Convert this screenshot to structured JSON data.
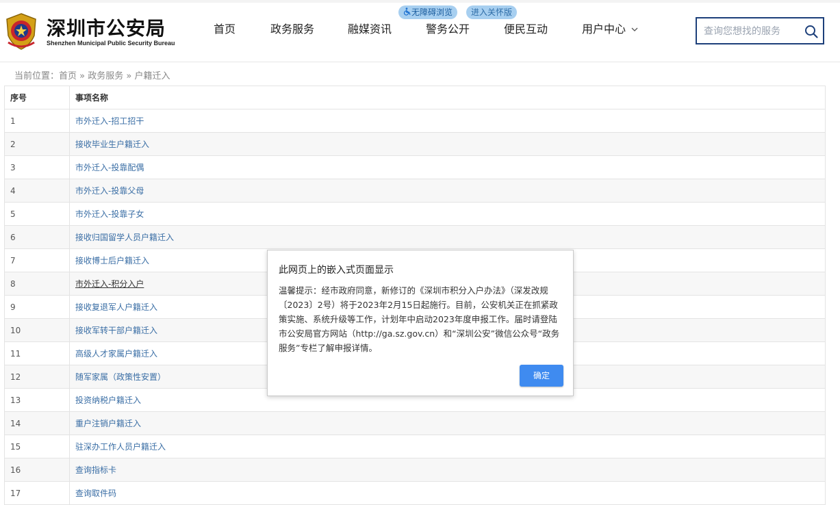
{
  "header": {
    "title_cn": "深圳市公安局",
    "title_en": "Shenzhen Municipal Public Security Bureau",
    "accessibility_label": "无障碍浏览",
    "elder_mode_label": "进入关怀版"
  },
  "nav": {
    "items": [
      "首页",
      "政务服务",
      "融媒资讯",
      "警务公开",
      "便民互动",
      "用户中心"
    ]
  },
  "search": {
    "placeholder": "查询您想找的服务"
  },
  "breadcrumb": {
    "prefix": "当前位置：",
    "home": "首页",
    "sep1": " » ",
    "section": "政务服务",
    "sep2": " » ",
    "current": "户籍迁入"
  },
  "table": {
    "headers": [
      "序号",
      "事项名称"
    ],
    "rows": [
      {
        "no": "1",
        "name": "市外迁入-招工招干"
      },
      {
        "no": "2",
        "name": "接收毕业生户籍迁入"
      },
      {
        "no": "3",
        "name": "市外迁入-投靠配偶"
      },
      {
        "no": "4",
        "name": "市外迁入-投靠父母"
      },
      {
        "no": "5",
        "name": "市外迁入-投靠子女"
      },
      {
        "no": "6",
        "name": "接收归国留学人员户籍迁入"
      },
      {
        "no": "7",
        "name": "接收博士后户籍迁入"
      },
      {
        "no": "8",
        "name": "市外迁入-积分入户"
      },
      {
        "no": "9",
        "name": "接收复退军人户籍迁入"
      },
      {
        "no": "10",
        "name": "接收军转干部户籍迁入"
      },
      {
        "no": "11",
        "name": "高级人才家属户籍迁入"
      },
      {
        "no": "12",
        "name": "随军家属（政策性安置）"
      },
      {
        "no": "13",
        "name": "投资纳税户籍迁入"
      },
      {
        "no": "14",
        "name": "重户注销户籍迁入"
      },
      {
        "no": "15",
        "name": "驻深办工作人员户籍迁入"
      },
      {
        "no": "16",
        "name": "查询指标卡"
      },
      {
        "no": "17",
        "name": "查询取件码"
      }
    ]
  },
  "dialog": {
    "title": "此网页上的嵌入式页面显示",
    "message": "温馨提示：经市政府同意，新修订的《深圳市积分入户办法》（深发改规〔2023〕2号）将于2023年2月15日起施行。目前，公安机关正在抓紧政策实施、系统升级等工作，计划年中启动2023年度申报工作。届时请登陆市公安局官方网站（http://ga.sz.gov.cn）和“深圳公安”微信公众号“政务服务”专栏了解申报详情。",
    "ok_label": "确定"
  },
  "colors": {
    "link": "#3a6ea5",
    "search_border": "#1c3f7a",
    "ok_button": "#3f8bf0",
    "pill": "#a7cff0"
  }
}
